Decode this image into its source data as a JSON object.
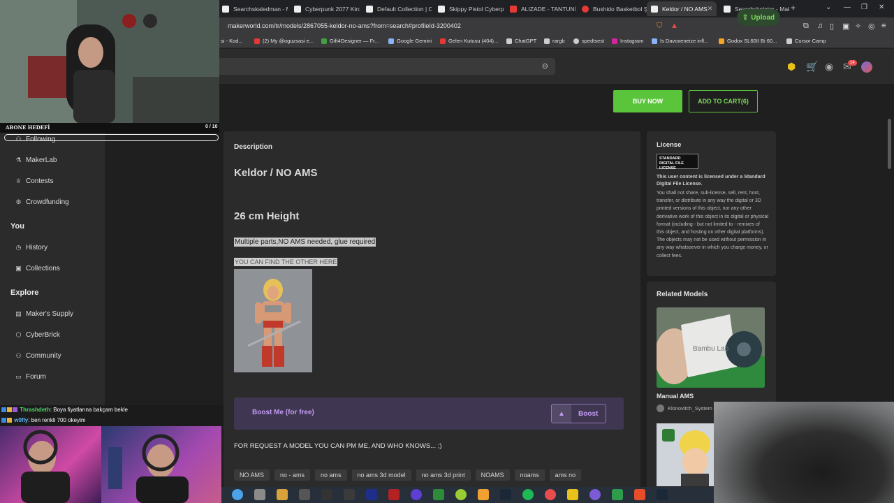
{
  "browser": {
    "tabs": [
      {
        "label": "Searchskaledman - M",
        "color": "#ffffff"
      },
      {
        "label": "Cyberpunk 2077 Kiro",
        "color": "#ffffff"
      },
      {
        "label": "Default Collection | C",
        "color": "#ffffff"
      },
      {
        "label": "Skippy Pistol Cyberpu",
        "color": "#ffffff"
      },
      {
        "label": "ALIZADE - TANTUNİ",
        "color": "#e53935"
      },
      {
        "label": "Bushido Basketbol Ş",
        "color": "#e53935"
      },
      {
        "label": "Keldor / NO AMS",
        "color": "#ffffff"
      },
      {
        "label": "Searchskeletor - Mak",
        "color": "#ffffff"
      }
    ],
    "new_tab": "+",
    "url": "makerworld.com/tr/models/2867055-keldor-no-ams?from=search#profileId-3200402",
    "bookmarks": [
      {
        "label": "si - Kod...",
        "color": "#4a90e2"
      },
      {
        "label": "(2) My @oguzsasi e...",
        "color": "#e53935"
      },
      {
        "label": "Gift4Designer — Fr...",
        "color": "#43a047"
      },
      {
        "label": "Google Gemini",
        "color": "#8ab4f8"
      },
      {
        "label": "Gelen Kutusu (404)...",
        "color": "#e53935"
      },
      {
        "label": "ChatGPT",
        "color": "#cccccc"
      },
      {
        "label": "rargb",
        "color": "#cccccc"
      },
      {
        "label": "spedtsest",
        "color": "#cccccc"
      },
      {
        "label": "Instagram",
        "color": "#d6249f"
      },
      {
        "label": "Is Davoxeneize infl...",
        "color": "#8ab4f8"
      },
      {
        "label": "Godox SL60II Bi 60...",
        "color": "#f5a623"
      },
      {
        "label": "Cursor Camp",
        "color": "#cccccc"
      }
    ]
  },
  "header": {
    "upload_label": "Upload",
    "notifications_count": "14"
  },
  "sidebar": {
    "items_top": [
      {
        "label": "Following",
        "icon": "person-icon"
      },
      {
        "label": "MakerLab",
        "icon": "flask-icon"
      },
      {
        "label": "Contests",
        "icon": "trophy-icon"
      },
      {
        "label": "Crowdfunding",
        "icon": "crowdfunding-icon"
      }
    ],
    "section_you": "You",
    "items_you": [
      {
        "label": "History",
        "icon": "history-icon"
      },
      {
        "label": "Collections",
        "icon": "collections-icon"
      }
    ],
    "section_explore": "Explore",
    "items_explore": [
      {
        "label": "Maker's Supply",
        "icon": "supply-icon"
      },
      {
        "label": "CyberBrick",
        "icon": "cyberbrick-icon"
      },
      {
        "label": "Community",
        "icon": "community-icon"
      },
      {
        "label": "Forum",
        "icon": "forum-icon"
      }
    ]
  },
  "actions": {
    "buy_now": "BUY NOW",
    "add_to_cart": "ADD TO CART(6)"
  },
  "description": {
    "label": "Description",
    "title": "Keldor / NO AMS",
    "height": "26 cm  Height",
    "line1": "Multiple parts,NO AMS needed, glue required",
    "line2": "YOU CAN FIND THE OTHER HERE"
  },
  "boost": {
    "text": "Boost Me (for free)",
    "button": "Boost"
  },
  "request_text": "FOR REQUEST A MODEL YOU CAN PM ME, AND WHO KNOWS... ;)",
  "tags": [
    "NO AMS",
    "no - ams",
    "no ams",
    "no ams 3d model",
    "no ams 3d print",
    "NOAMS",
    "noams",
    "ams no"
  ],
  "license": {
    "title": "License",
    "badge": "STANDARD DIGITAL FILE LICENSE",
    "bold": "This user content is licensed under a Standard Digital File License.",
    "text": "You shall not share, sub-license, sell, rent, host, transfer, or distribute in any way the digital or 3D printed versions of this object, nor any other derivative work of this object in its digital or physical format (including - but not limited to - remixes of this object, and hosting on other digital platforms). The objects may not be used without permission in any way whatsoever in which you charge money, or collect fees."
  },
  "related": {
    "title": "Related Models",
    "model_name": "Manual AMS",
    "author": "Klonovitch_System",
    "image_text": "Bambu Lab"
  },
  "stream": {
    "goal_label": "ABONE HEDEFİ",
    "goal_count": "0 / 10",
    "goal_progress": 0,
    "chat": [
      {
        "user": "Thrashdeth",
        "message": ": Boya fiyatlarına bakçam bekle"
      },
      {
        "user": "w0fly",
        "message": ": ben renkli 700 okeyim"
      }
    ]
  }
}
